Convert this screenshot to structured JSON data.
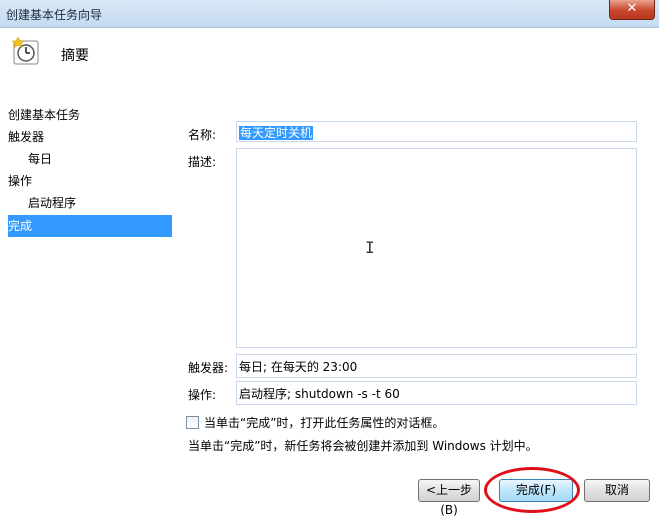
{
  "window": {
    "title": "创建基本任务向导",
    "close_glyph": "✕"
  },
  "header": {
    "title": "摘要",
    "icon": "task-scheduler-clock-icon"
  },
  "nav": {
    "items": [
      {
        "label": "创建基本任务",
        "sub": false,
        "selected": false
      },
      {
        "label": "触发器",
        "sub": false,
        "selected": false
      },
      {
        "label": "每日",
        "sub": true,
        "selected": false
      },
      {
        "label": "操作",
        "sub": false,
        "selected": false
      },
      {
        "label": "启动程序",
        "sub": true,
        "selected": false
      },
      {
        "label": "完成",
        "sub": false,
        "selected": true
      }
    ]
  },
  "form": {
    "name_label": "名称:",
    "name_value": "每天定时关机",
    "desc_label": "描述:",
    "desc_value": "",
    "trigger_label": "触发器:",
    "trigger_value": "每日; 在每天的 23:00",
    "action_label": "操作:",
    "action_value": "启动程序; shutdown -s -t 60",
    "open_props_label": "当单击“完成”时，打开此任务属性的对话框。",
    "open_props_checked": false,
    "info_text": "当单击“完成”时，新任务将会被创建并添加到 Windows 计划中。"
  },
  "buttons": {
    "back": "<上一步(B)",
    "finish": "完成(F)",
    "cancel": "取消"
  },
  "colors": {
    "selection": "#3399ff",
    "annotation": "#e0101a"
  }
}
